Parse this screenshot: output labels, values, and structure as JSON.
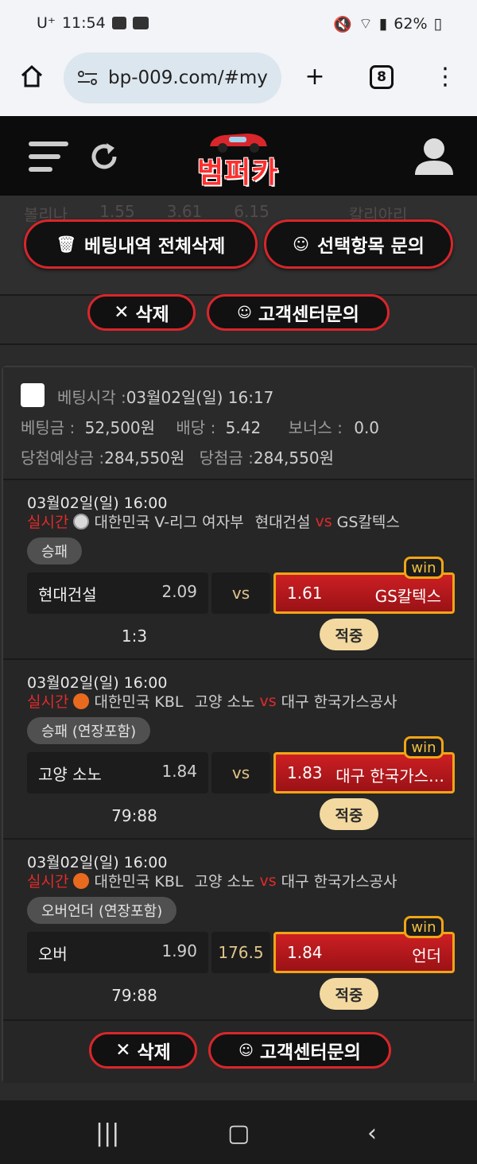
{
  "status": {
    "carrier": "U⁺",
    "time": "11:54",
    "battery": "62%"
  },
  "browser": {
    "url": "bp-009.com/#my",
    "tabs": "8"
  },
  "site": {
    "logo": "범퍼카"
  },
  "ghost_row": [
    "볼리나",
    "1.55",
    "3.61",
    "6.15",
    "칼리아리"
  ],
  "actions": {
    "delete_all": "베팅내역 전체삭제",
    "inquire_selected": "선택항목 문의",
    "delete": "삭제",
    "support": "고객센터문의"
  },
  "bet": {
    "time_label": "베팅시각 :",
    "time": "03월02일(일) 16:17",
    "amount_label": "베팅금 :",
    "amount": "52,500원",
    "odds_label": "배당 :",
    "odds": "5.42",
    "bonus_label": "보너스 :",
    "bonus": "0.0",
    "expected_label": "당첨예상금 :",
    "expected": "284,550원",
    "won_label": "당첨금 :",
    "won": "284,550원"
  },
  "games": [
    {
      "time": "03월02일(일) 16:00",
      "live": "실시간",
      "league": "대한민국 V-리그 여자부",
      "home": "현대건설",
      "vs": "vs",
      "away": "GS칼텍스",
      "market": "승패",
      "home_pick": "현대건설",
      "home_odd": "2.09",
      "mid": "vs",
      "away_odd": "1.61",
      "away_pick": "GS칼텍스",
      "win": "win",
      "score": "1:3",
      "result": "적중"
    },
    {
      "time": "03월02일(일) 16:00",
      "live": "실시간",
      "league": "대한민국 KBL",
      "home": "고양 소노",
      "vs": "vs",
      "away": "대구 한국가스공사",
      "market": "승패 (연장포함)",
      "home_pick": "고양 소노",
      "home_odd": "1.84",
      "mid": "vs",
      "away_odd": "1.83",
      "away_pick": "대구 한국가스…",
      "win": "win",
      "score": "79:88",
      "result": "적중"
    },
    {
      "time": "03월02일(일) 16:00",
      "live": "실시간",
      "league": "대한민국 KBL",
      "home": "고양 소노",
      "vs": "vs",
      "away": "대구 한국가스공사",
      "market": "오버언더 (연장포함)",
      "home_pick": "오버",
      "home_odd": "1.90",
      "mid": "176.5",
      "away_odd": "1.84",
      "away_pick": "언더",
      "win": "win",
      "score": "79:88",
      "result": "적중"
    }
  ],
  "colors": {
    "accent_red": "#d8262b",
    "win_gold": "#f0a516",
    "hit_bg": "#f3d9a0"
  }
}
